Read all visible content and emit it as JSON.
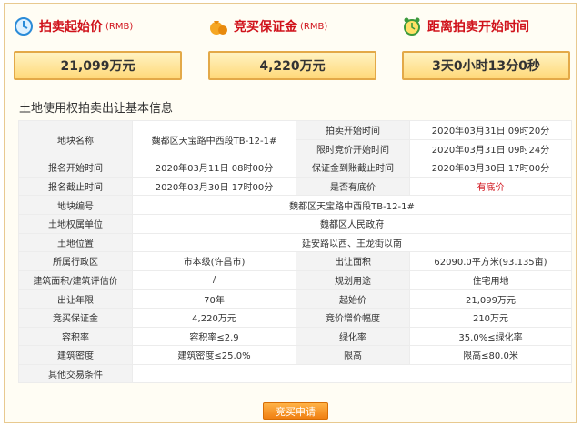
{
  "panels": [
    {
      "label": "拍卖起始价",
      "unit": "(RMB)",
      "value": "21,099万元",
      "icon": "clock-icon"
    },
    {
      "label": "竞买保证金",
      "unit": "(RMB)",
      "value": "4,220万元",
      "icon": "money-bag-icon"
    },
    {
      "label": "距离拍卖开始时间",
      "unit": "",
      "value": "3天0小时13分0秒",
      "icon": "alarm-clock-icon"
    }
  ],
  "section_title": "土地使用权拍卖出让基本信息",
  "info": {
    "parcel_name_label": "地块名称",
    "parcel_name_value": "魏都区天宝路中西段TB-12-1#",
    "auction_start_label": "拍卖开始时间",
    "auction_start_value": "2020年03月31日 09时20分",
    "limit_start_label": "限时竞价开始时间",
    "limit_start_value": "2020年03月31日 09时24分",
    "reg_start_label": "报名开始时间",
    "reg_start_value": "2020年03月11日 08时00分",
    "deposit_deadline_label": "保证金到账截止时间",
    "deposit_deadline_value": "2020年03月30日 17时00分",
    "reg_end_label": "报名截止时间",
    "reg_end_value": "2020年03月30日 17时00分",
    "reserve_label": "是否有底价",
    "reserve_value": "有底价",
    "parcel_no_label": "地块编号",
    "parcel_no_value": "魏都区天宝路中西段TB-12-1#",
    "owner_label": "土地权属单位",
    "owner_value": "魏都区人民政府",
    "location_label": "土地位置",
    "location_value": "延安路以西、王龙街以南",
    "district_label": "所属行政区",
    "district_value": "市本级(许昌市)",
    "area_label": "出让面积",
    "area_value": "62090.0平方米(93.135亩)",
    "building_area_label": "建筑面积/建筑评估价",
    "building_area_value": "/",
    "use_label": "规划用途",
    "use_value": "住宅用地",
    "years_label": "出让年限",
    "years_value": "70年",
    "start_price_label": "起始价",
    "start_price_value": "21,099万元",
    "bid_deposit_label": "竞买保证金",
    "bid_deposit_value": "4,220万元",
    "increment_label": "竞价增价幅度",
    "increment_value": "210万元",
    "far_label": "容积率",
    "far_value": "容积率≤2.9",
    "green_label": "绿化率",
    "green_value": "35.0%≤绿化率",
    "density_label": "建筑密度",
    "density_value": "建筑密度≤25.0%",
    "height_label": "限高",
    "height_value": "限高≤80.0米",
    "other_label": "其他交易条件",
    "other_value": ""
  },
  "apply_button": "竞买申请",
  "colors": {
    "accent_red": "#d0121b",
    "box_border": "#e3a948",
    "button": "#f07f12"
  }
}
